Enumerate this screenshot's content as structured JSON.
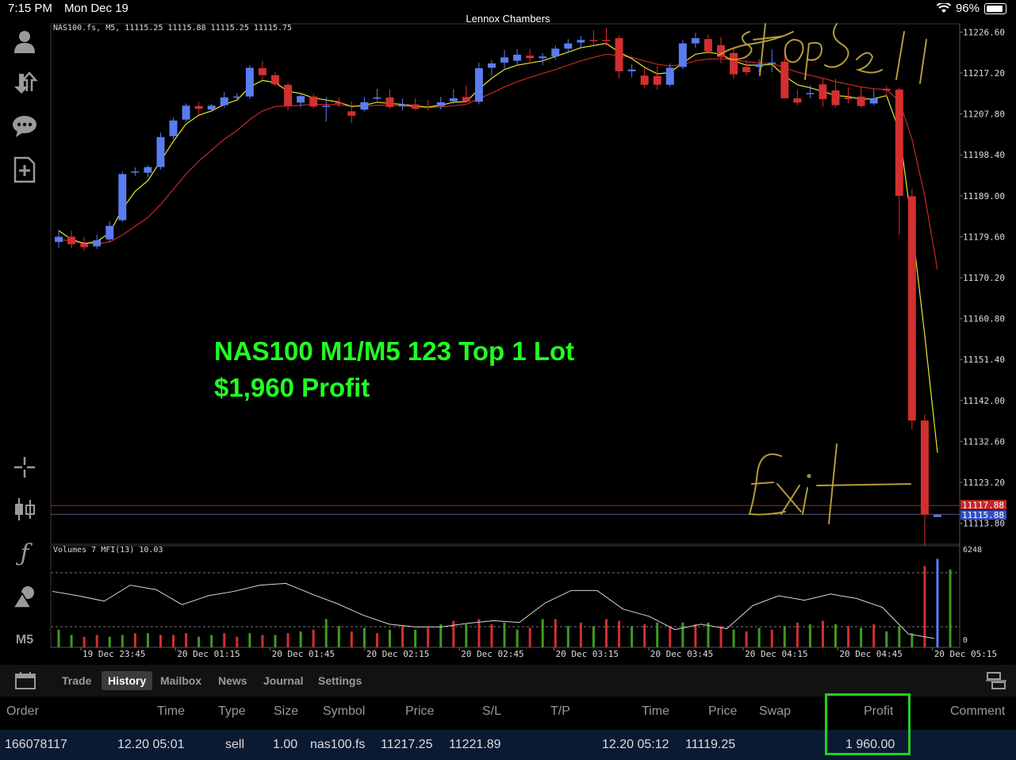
{
  "status_bar": {
    "time": "7:15 PM",
    "date": "Mon Dec 19",
    "title": "Lennox Chambers",
    "battery": "96%"
  },
  "toolbar_icons": [
    "account-icon",
    "trade-arrows-icon",
    "chat-icon",
    "new-order-icon",
    "crosshair-icon",
    "candles-icon",
    "function-icon",
    "objects-icon"
  ],
  "timeframe": "M5",
  "chart_data": {
    "type": "candlestick",
    "symbol_header": "NAS100.fs, M5, 11115.25 11115.88 11115.25 11115.75",
    "price_ticks": [
      "11226.60",
      "11217.20",
      "11207.80",
      "11198.40",
      "11189.00",
      "11179.60",
      "11170.20",
      "11160.80",
      "11151.40",
      "11142.00",
      "11132.60",
      "11123.20",
      "11113.80"
    ],
    "ylim": [
      11109.0,
      11228.5
    ],
    "current_price_red": "11117.88",
    "current_price_blue": "11115.88",
    "red_line_price": 11117.88,
    "blue_line_price": 11115.88,
    "time_labels": [
      "19 Dec 23:45",
      "20 Dec 01:15",
      "20 Dec 01:45",
      "20 Dec 02:15",
      "20 Dec 02:45",
      "20 Dec 03:15",
      "20 Dec 03:45",
      "20 Dec 04:15",
      "20 Dec 04:45",
      "20 Dec 05:15"
    ],
    "candles": [
      [
        11178.4,
        11181.2,
        11177.0,
        11179.6
      ],
      [
        11179.6,
        11181.0,
        11176.9,
        11177.9
      ],
      [
        11178.0,
        11179.6,
        11176.3,
        11177.2
      ],
      [
        11177.4,
        11180.1,
        11176.8,
        11178.8
      ],
      [
        11179.0,
        11183.2,
        11178.4,
        11182.1
      ],
      [
        11183.4,
        11194.6,
        11183.0,
        11194.0
      ],
      [
        11194.6,
        11195.5,
        11193.6,
        11194.6
      ],
      [
        11194.3,
        11196.0,
        11193.3,
        11195.6
      ],
      [
        11195.6,
        11203.5,
        11195.0,
        11202.5
      ],
      [
        11202.7,
        11207.0,
        11202.0,
        11206.3
      ],
      [
        11206.5,
        11210.2,
        11206.0,
        11209.7
      ],
      [
        11209.6,
        11210.6,
        11207.6,
        11209.0
      ],
      [
        11208.8,
        11210.1,
        11208.2,
        11209.7
      ],
      [
        11209.8,
        11212.8,
        11209.2,
        11211.6
      ],
      [
        11211.6,
        11212.6,
        11211.0,
        11211.8
      ],
      [
        11211.8,
        11219.0,
        11211.2,
        11218.4
      ],
      [
        11218.3,
        11220.0,
        11215.6,
        11216.7
      ],
      [
        11216.7,
        11217.4,
        11214.2,
        11214.6
      ],
      [
        11214.5,
        11215.0,
        11208.6,
        11209.7
      ],
      [
        11210.4,
        11212.7,
        11209.3,
        11211.9
      ],
      [
        11211.8,
        11212.5,
        11209.1,
        11209.5
      ],
      [
        11209.7,
        11211.7,
        11206.0,
        11209.7
      ],
      [
        11210.4,
        11211.6,
        11209.4,
        11210.1
      ],
      [
        11208.4,
        11210.7,
        11205.7,
        11207.4
      ],
      [
        11208.8,
        11211.7,
        11208.4,
        11210.5
      ],
      [
        11211.3,
        11213.6,
        11210.9,
        11211.6
      ],
      [
        11211.6,
        11213.4,
        11209.0,
        11209.4
      ],
      [
        11209.6,
        11211.4,
        11208.6,
        11210.0
      ],
      [
        11210.0,
        11211.4,
        11208.7,
        11209.0
      ],
      [
        11209.4,
        11211.0,
        11208.6,
        11209.2
      ],
      [
        11209.6,
        11211.7,
        11208.8,
        11210.5
      ],
      [
        11210.7,
        11213.5,
        11210.1,
        11211.4
      ],
      [
        11211.7,
        11214.4,
        11211.0,
        11210.6
      ],
      [
        11210.6,
        11219.6,
        11210.0,
        11218.3
      ],
      [
        11218.4,
        11220.2,
        11216.4,
        11219.4
      ],
      [
        11219.6,
        11222.5,
        11217.8,
        11220.8
      ],
      [
        11220.0,
        11222.7,
        11219.0,
        11221.4
      ],
      [
        11221.2,
        11222.8,
        11219.3,
        11220.6
      ],
      [
        11220.6,
        11221.8,
        11219.0,
        11221.0
      ],
      [
        11221.0,
        11223.5,
        11220.2,
        11222.8
      ],
      [
        11222.8,
        11225.0,
        11221.8,
        11224.0
      ],
      [
        11224.2,
        11225.7,
        11223.0,
        11224.8
      ],
      [
        11224.8,
        11227.0,
        11223.2,
        11224.6
      ],
      [
        11224.8,
        11227.6,
        11223.4,
        11224.7
      ],
      [
        11225.2,
        11225.8,
        11216.0,
        11217.6
      ],
      [
        11217.6,
        11219.2,
        11216.2,
        11218.0
      ],
      [
        11216.6,
        11218.3,
        11213.9,
        11214.5
      ],
      [
        11216.5,
        11218.8,
        11213.4,
        11214.5
      ],
      [
        11214.5,
        11219.4,
        11214.0,
        11218.4
      ],
      [
        11218.6,
        11224.8,
        11218.0,
        11224.0
      ],
      [
        11224.0,
        11226.4,
        11223.0,
        11225.2
      ],
      [
        11225.0,
        11226.0,
        11221.6,
        11222.2
      ],
      [
        11223.6,
        11225.5,
        11219.4,
        11220.9
      ],
      [
        11221.8,
        11222.9,
        11215.8,
        11216.9
      ],
      [
        11218.6,
        11220.1,
        11216.6,
        11217.4
      ],
      [
        11218.6,
        11220.4,
        11217.4,
        11219.2
      ],
      [
        11219.6,
        11222.6,
        11217.4,
        11219.6
      ],
      [
        11219.8,
        11222.0,
        11216.6,
        11211.4
      ],
      [
        11211.4,
        11213.3,
        11209.8,
        11210.4
      ],
      [
        11212.5,
        11214.4,
        11211.4,
        11212.6
      ],
      [
        11214.6,
        11216.0,
        11209.4,
        11211.2
      ],
      [
        11213.2,
        11215.9,
        11209.2,
        11209.8
      ],
      [
        11211.6,
        11213.9,
        11210.2,
        11211.2
      ],
      [
        11211.8,
        11214.0,
        11209.2,
        11209.6
      ],
      [
        11210.2,
        11213.6,
        11209.8,
        11211.4
      ],
      [
        11213.6,
        11214.2,
        11211.8,
        11213.2
      ],
      [
        11213.4,
        11213.8,
        11180.0,
        11189.0
      ],
      [
        11188.9,
        11190.6,
        11135.4,
        11137.4
      ],
      [
        11137.4,
        11138.8,
        11108.6,
        11115.8
      ],
      [
        11115.25,
        11115.88,
        11115.25,
        11115.75
      ]
    ],
    "ma_fast": [
      11181.0,
      11179.0,
      11178.0,
      11178.5,
      11180.5,
      11186.0,
      11190.0,
      11192.5,
      11197.0,
      11201.5,
      11205.5,
      11207.5,
      11208.5,
      11210.0,
      11211.0,
      11214.0,
      11215.5,
      11215.0,
      11213.0,
      11212.5,
      11211.5,
      11211.0,
      11210.5,
      11209.5,
      11209.8,
      11210.5,
      11210.2,
      11210.0,
      11209.6,
      11209.4,
      11209.8,
      11210.5,
      11210.6,
      11213.5,
      11216.0,
      11218.0,
      11219.0,
      11219.5,
      11220.0,
      11221.0,
      11222.0,
      11223.0,
      11223.5,
      11224.0,
      11222.0,
      11220.5,
      11218.5,
      11217.0,
      11217.3,
      11219.5,
      11221.5,
      11222.0,
      11221.5,
      11220.0,
      11219.0,
      11219.0,
      11219.2,
      11216.5,
      11214.5,
      11213.8,
      11213.0,
      11212.0,
      11211.8,
      11211.2,
      11211.3,
      11212.0,
      11204.0,
      11182.0,
      11157.0,
      11130.0
    ],
    "ma_slow": [
      11179.0,
      11178.6,
      11178.2,
      11178.0,
      11178.4,
      11180.0,
      11182.0,
      11184.0,
      11187.0,
      11190.5,
      11194.0,
      11197.0,
      11199.5,
      11202.0,
      11204.0,
      11206.5,
      11208.5,
      11209.5,
      11209.6,
      11209.8,
      11210.0,
      11210.0,
      11209.9,
      11209.6,
      11209.6,
      11209.8,
      11209.8,
      11209.6,
      11209.5,
      11209.3,
      11209.4,
      11209.7,
      11210.0,
      11211.3,
      11212.6,
      11214.0,
      11215.2,
      11216.2,
      11217.1,
      11218.0,
      11219.0,
      11220.0,
      11220.8,
      11221.5,
      11221.2,
      11220.8,
      11220.0,
      11219.2,
      11218.8,
      11219.2,
      11220.0,
      11220.4,
      11220.5,
      11220.2,
      11219.8,
      11219.5,
      11219.4,
      11218.4,
      11217.4,
      11216.7,
      11216.0,
      11215.2,
      11214.6,
      11214.0,
      11213.6,
      11213.4,
      11210.8,
      11202.0,
      11189.0,
      11172.0
    ],
    "volume_indicator_label": "Volumes 7 MFI(13) 10.03",
    "volume_max_label": "6248",
    "volume_zero_label": "0",
    "mfi_line": [
      63,
      58,
      52,
      70,
      65,
      48,
      58,
      63,
      70,
      72,
      60,
      49,
      36,
      26,
      23,
      23,
      27,
      30,
      28,
      50,
      64,
      64,
      43,
      35,
      20,
      26,
      21,
      47,
      58,
      53,
      60,
      55,
      45,
      15,
      10
    ],
    "volume_bars_dir": [
      "g",
      "g",
      "r",
      "r",
      "g",
      "g",
      "r",
      "g",
      "r",
      "r",
      "r",
      "g",
      "g",
      "r",
      "r",
      "g",
      "r",
      "g",
      "r",
      "g",
      "r",
      "g",
      "g",
      "r",
      "g",
      "r",
      "g",
      "r",
      "g",
      "r",
      "g",
      "r",
      "g",
      "r",
      "r",
      "g",
      "g",
      "r",
      "g",
      "r",
      "g",
      "r",
      "g",
      "r",
      "r",
      "g",
      "r",
      "g",
      "r",
      "g",
      "r",
      "g",
      "r",
      "g",
      "r",
      "g",
      "r",
      "g",
      "r",
      "g",
      "r",
      "g",
      "r",
      "g",
      "r",
      "g",
      "g",
      "g",
      "r",
      "b"
    ],
    "volume_values": [
      1.0,
      0.7,
      0.6,
      0.7,
      0.6,
      0.7,
      0.8,
      0.8,
      0.7,
      0.7,
      0.8,
      0.6,
      0.7,
      0.8,
      0.6,
      0.8,
      0.7,
      0.7,
      0.8,
      0.9,
      1.0,
      1.6,
      1.2,
      0.9,
      1.1,
      0.8,
      1.0,
      1.2,
      1.0,
      1.1,
      1.3,
      1.5,
      1.3,
      1.6,
      1.3,
      1.4,
      1.0,
      1.1,
      1.6,
      1.6,
      1.2,
      1.4,
      1.2,
      1.6,
      1.5,
      1.2,
      1.3,
      1.4,
      1.2,
      1.4,
      1.3,
      1.4,
      1.2,
      1.0,
      0.9,
      1.1,
      1.0,
      1.2,
      1.4,
      1.3,
      1.5,
      1.3,
      1.2,
      1.1,
      1.3,
      0.9,
      1.2,
      0.8,
      4.6,
      5.0,
      4.4
    ]
  },
  "overlay": {
    "line1": "NAS100 M1/M5 123 Top 1 Lot",
    "line2": "$1,960 Profit"
  },
  "annotations": {
    "top": "Stop Sell",
    "bottom": "Exit"
  },
  "tabs": [
    "Trade",
    "History",
    "Mailbox",
    "News",
    "Journal",
    "Settings"
  ],
  "active_tab": "History",
  "history": {
    "headers": {
      "order": "Order",
      "time": "Time",
      "type": "Type",
      "size": "Size",
      "symbol": "Symbol",
      "price": "Price",
      "sl": "S/L",
      "tp": "T/P",
      "time2": "Time",
      "price2": "Price",
      "swap": "Swap",
      "profit": "Profit",
      "comment": "Comment"
    },
    "row": {
      "order": "166078117",
      "time": "12.20 05:01",
      "type": "sell",
      "size": "1.00",
      "symbol": "nas100.fs",
      "price": "11217.25",
      "sl": "11221.89",
      "tp": "",
      "time2": "12.20 05:12",
      "price2": "11119.25",
      "swap": "",
      "profit": "1 960.00",
      "comment": ""
    }
  }
}
